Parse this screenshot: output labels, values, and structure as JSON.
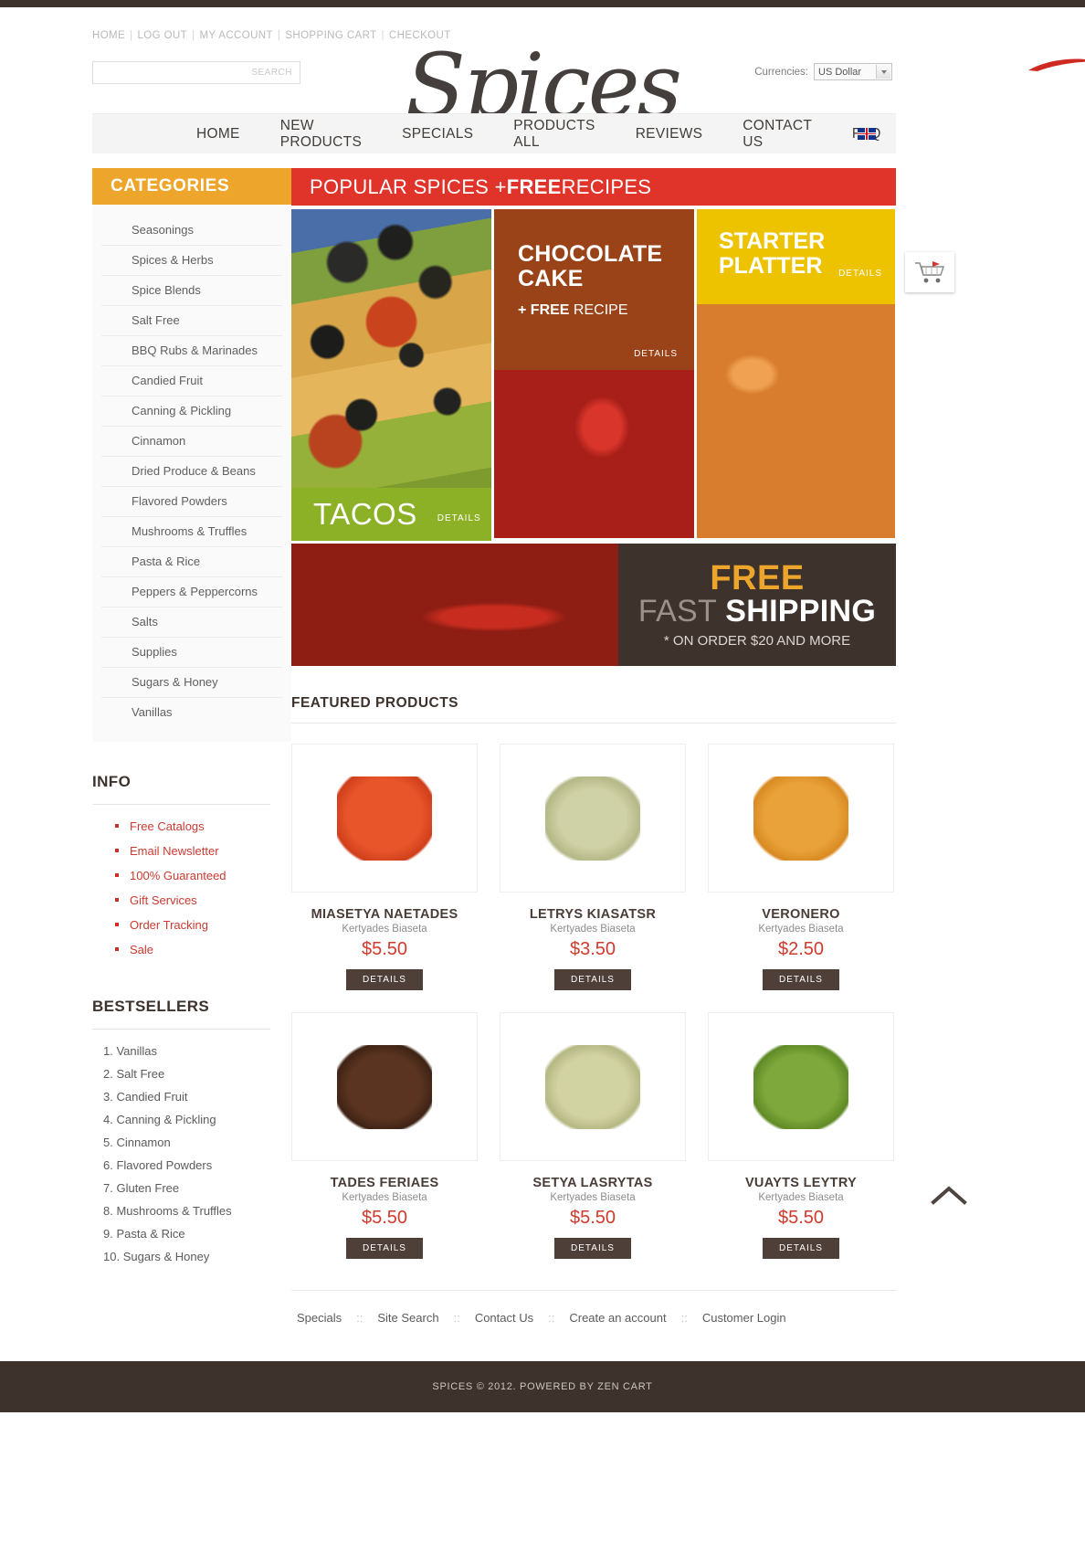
{
  "utility_nav": [
    {
      "label": "HOME"
    },
    {
      "label": "LOG OUT"
    },
    {
      "label": "MY ACCOUNT"
    },
    {
      "label": "SHOPPING CART"
    },
    {
      "label": "CHECKOUT"
    }
  ],
  "logo": {
    "text": "Spices"
  },
  "search": {
    "value": "",
    "placeholder": "",
    "button_label": "SEARCH"
  },
  "currency": {
    "label": "Currencies:",
    "selected": "US Dollar"
  },
  "main_nav": [
    {
      "label": "HOME"
    },
    {
      "label": "NEW PRODUCTS"
    },
    {
      "label": "SPECIALS"
    },
    {
      "label": "PRODUCTS ALL"
    },
    {
      "label": "REVIEWS"
    },
    {
      "label": "CONTACT US"
    },
    {
      "label": "FAQ"
    }
  ],
  "language_flag": "uk-flag-icon",
  "categories": {
    "title": "CATEGORIES",
    "items": [
      {
        "label": "Seasonings"
      },
      {
        "label": "Spices & Herbs"
      },
      {
        "label": "Spice Blends"
      },
      {
        "label": "Salt Free"
      },
      {
        "label": "BBQ Rubs & Marinades"
      },
      {
        "label": "Candied Fruit"
      },
      {
        "label": "Canning & Pickling"
      },
      {
        "label": "Cinnamon"
      },
      {
        "label": "Dried Produce & Beans"
      },
      {
        "label": "Flavored Powders"
      },
      {
        "label": "Mushrooms & Truffles"
      },
      {
        "label": "Pasta & Rice"
      },
      {
        "label": "Peppers & Peppercorns"
      },
      {
        "label": "Salts"
      },
      {
        "label": "Supplies"
      },
      {
        "label": "Sugars & Honey"
      },
      {
        "label": "Vanillas"
      }
    ]
  },
  "info": {
    "title": "INFO",
    "items": [
      {
        "label": "Free Catalogs"
      },
      {
        "label": "Email Newsletter"
      },
      {
        "label": "100% Guaranteed"
      },
      {
        "label": "Gift Services"
      },
      {
        "label": "Order Tracking"
      },
      {
        "label": "Sale"
      }
    ]
  },
  "bestsellers": {
    "title": "BESTSELLERS",
    "items": [
      {
        "label": "Vanillas"
      },
      {
        "label": "Salt Free"
      },
      {
        "label": "Candied Fruit"
      },
      {
        "label": "Canning & Pickling"
      },
      {
        "label": "Cinnamon"
      },
      {
        "label": "Flavored Powders"
      },
      {
        "label": "Gluten Free"
      },
      {
        "label": "Mushrooms & Truffles"
      },
      {
        "label": "Pasta & Rice"
      },
      {
        "label": "Sugars & Honey"
      }
    ]
  },
  "promo": {
    "banner_prefix": "POPULAR SPICES + ",
    "banner_bold": "FREE",
    "banner_suffix": " RECIPES",
    "tiles": {
      "tacos": {
        "title": "TACOS",
        "details": "DETAILS"
      },
      "chocolate": {
        "title": "CHOCOLATE CAKE",
        "sub_bold": "+ FREE",
        "sub_rest": " RECIPE",
        "details": "DETAILS"
      },
      "starter": {
        "title": "STARTER PLATTER",
        "details": "DETAILS"
      }
    }
  },
  "shipping": {
    "free": "FREE",
    "fast": "FAST ",
    "shipping": "SHIPPING",
    "note": "* ON ORDER $20 AND MORE"
  },
  "featured": {
    "title": "FEATURED PRODUCTS",
    "products": [
      {
        "name": "MIASETYA NAETADES",
        "sub": "Kertyades Biaseta",
        "price": "$5.50",
        "button": "DETAILS",
        "swatch": "blob-red"
      },
      {
        "name": "LETRYS KIASATSR",
        "sub": "Kertyades Biaseta",
        "price": "$3.50",
        "button": "DETAILS",
        "swatch": "blob-green1"
      },
      {
        "name": "VERONERO",
        "sub": "Kertyades Biaseta",
        "price": "$2.50",
        "button": "DETAILS",
        "swatch": "blob-orange"
      },
      {
        "name": "TADES FERIAES",
        "sub": "Kertyades Biaseta",
        "price": "$5.50",
        "button": "DETAILS",
        "swatch": "blob-brown"
      },
      {
        "name": "SETYA LASRYTAS",
        "sub": "Kertyades Biaseta",
        "price": "$5.50",
        "button": "DETAILS",
        "swatch": "blob-green2"
      },
      {
        "name": "VUAYTS LEYTRY",
        "sub": "Kertyades Biaseta",
        "price": "$5.50",
        "button": "DETAILS",
        "swatch": "blob-green3"
      }
    ]
  },
  "footer": {
    "links": [
      {
        "label": "Specials"
      },
      {
        "label": "Site Search"
      },
      {
        "label": "Contact Us"
      },
      {
        "label": "Create an account"
      },
      {
        "label": "Customer Login"
      }
    ],
    "separator": "::",
    "copyright": "SPICES © 2012. POWERED BY ZEN CART"
  },
  "colors": {
    "accent_orange": "#eda62b",
    "accent_red": "#e0332a",
    "dark_brown": "#3d322c",
    "green": "#8cb026",
    "yellow": "#edc300",
    "choc_brown": "#9a4318"
  }
}
